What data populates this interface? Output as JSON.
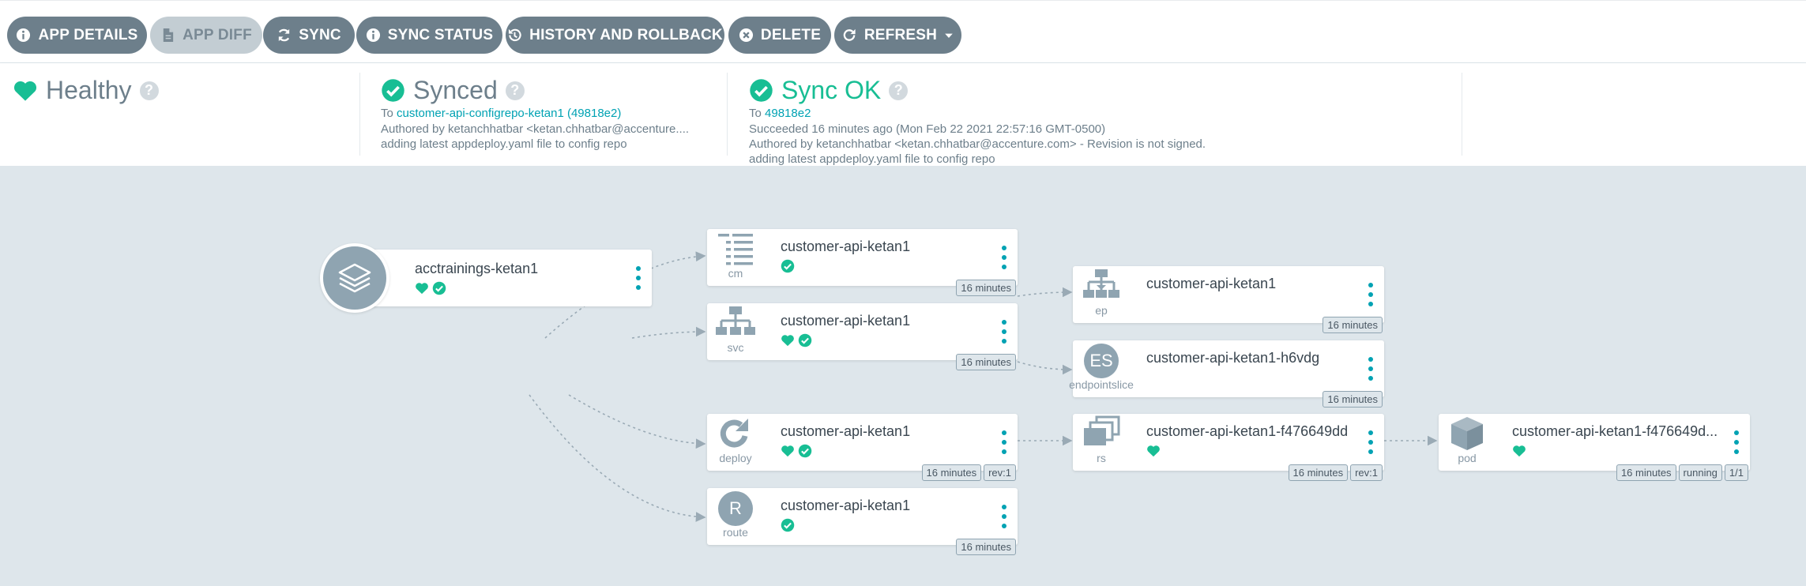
{
  "toolbar": {
    "buttons": [
      {
        "label": "APP DETAILS",
        "icon": "info-circle-icon",
        "enabled": true
      },
      {
        "label": "APP DIFF",
        "icon": "file-icon",
        "enabled": false
      },
      {
        "label": "SYNC",
        "icon": "sync-icon",
        "enabled": true
      },
      {
        "label": "SYNC STATUS",
        "icon": "info-circle-icon",
        "enabled": true
      },
      {
        "label": "HISTORY AND ROLLBACK",
        "icon": "history-icon",
        "enabled": true
      },
      {
        "label": "DELETE",
        "icon": "times-circle-icon",
        "enabled": true
      },
      {
        "label": "REFRESH",
        "icon": "redo-icon",
        "enabled": true
      }
    ]
  },
  "status": {
    "health": {
      "label": "Healthy",
      "icon": "heart-icon"
    },
    "sync": {
      "label": "Synced",
      "to_prefix": "To",
      "to_link": "customer-api-configrepo-ketan1 (49818e2)",
      "authored": "Authored by ketanchhatbar <ketan.chhatbar@accenture....",
      "message": "adding latest appdeploy.yaml file to config repo"
    },
    "operation": {
      "label": "Sync OK",
      "to_prefix": "To",
      "to_link": "49818e2",
      "succeeded": "Succeeded 16 minutes ago (Mon Feb 22 2021 22:57:16 GMT-0500)",
      "authored": "Authored by ketanchhatbar <ketan.chhatbar@accenture.com> - Revision is not signed.",
      "message": "adding latest appdeploy.yaml file to config repo"
    },
    "help_glyph": "?"
  },
  "graph": {
    "app": {
      "name": "acctrainings-ketan1",
      "icon": "layers-icon"
    },
    "nodes": {
      "cm": {
        "name": "customer-api-ketan1",
        "kind": "cm",
        "tags": [
          "16 minutes"
        ]
      },
      "svc": {
        "name": "customer-api-ketan1",
        "kind": "svc",
        "tags": [
          "16 minutes"
        ]
      },
      "deploy": {
        "name": "customer-api-ketan1",
        "kind": "deploy",
        "tags": [
          "16 minutes",
          "rev:1"
        ]
      },
      "route": {
        "name": "customer-api-ketan1",
        "kind": "route",
        "letter": "R",
        "tags": [
          "16 minutes"
        ]
      },
      "ep": {
        "name": "customer-api-ketan1",
        "kind": "ep",
        "tags": [
          "16 minutes"
        ]
      },
      "es": {
        "name": "customer-api-ketan1-h6vdg",
        "kind": "endpointslice",
        "letter": "ES",
        "tags": [
          "16 minutes"
        ]
      },
      "rs": {
        "name": "customer-api-ketan1-f476649dd",
        "kind": "rs",
        "tags": [
          "16 minutes",
          "rev:1"
        ]
      },
      "pod": {
        "name": "customer-api-ketan1-f476649d...",
        "kind": "pod",
        "tags": [
          "16 minutes",
          "running",
          "1/1"
        ]
      }
    }
  },
  "colors": {
    "teal": "#18be94",
    "link": "#00a2b3",
    "button": "#6d7f8b",
    "graph_bg": "#dee6eb"
  }
}
